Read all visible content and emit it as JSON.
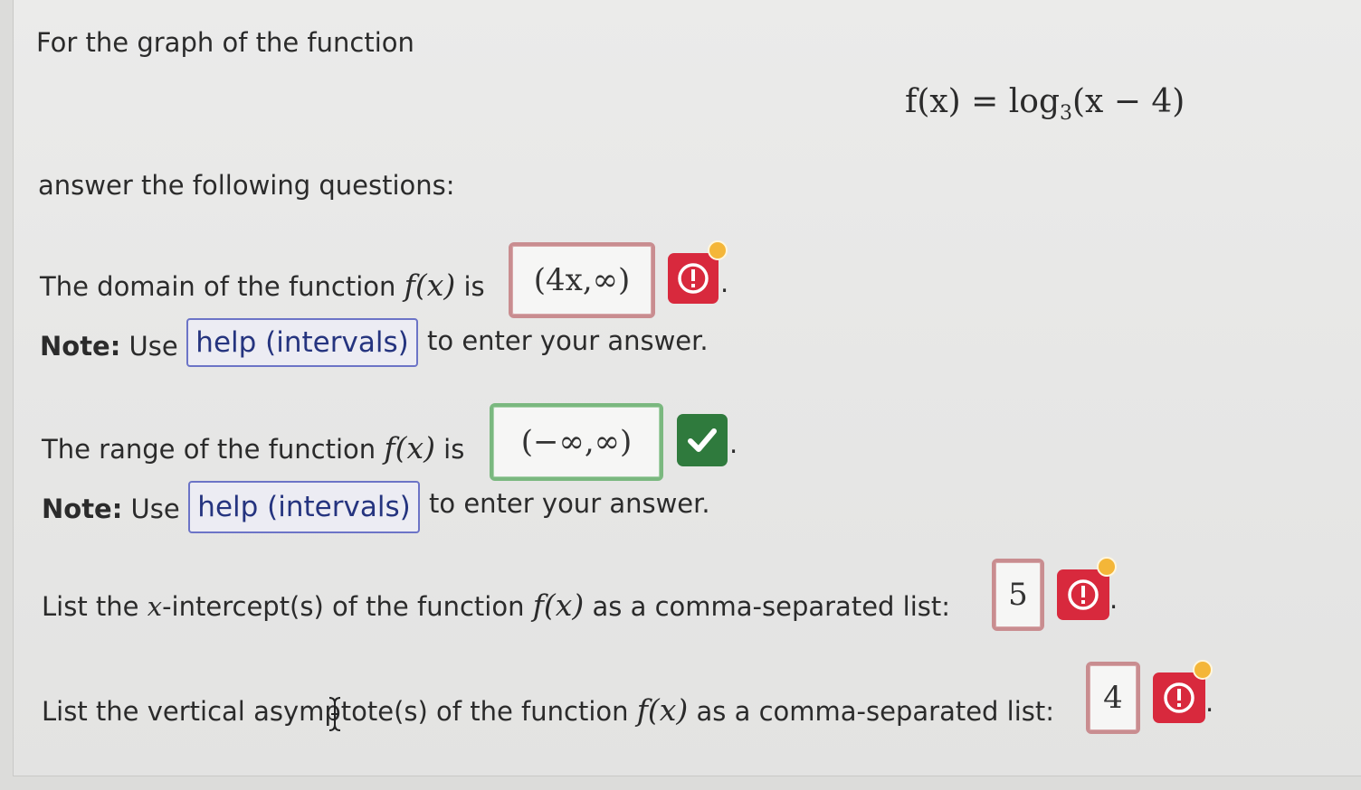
{
  "intro": "For the graph of the function",
  "formula": {
    "lhs": "f(x) = log",
    "base": "3",
    "arg": "(x − 4)"
  },
  "prompt": "answer the following questions:",
  "domain": {
    "text_before": "The domain of the function",
    "func": "f(x)",
    "text_after": "is",
    "answer": "(4x,∞)",
    "status": "error"
  },
  "range": {
    "text_before": "The range of the function",
    "func": "f(x)",
    "text_after": "is",
    "answer": "(−∞,∞)",
    "status": "correct"
  },
  "note": {
    "label": "Note:",
    "use": "Use",
    "help": "help (intervals)",
    "after": "to enter your answer."
  },
  "xint": {
    "text_before": "List the",
    "var": "x",
    "text_mid": "-intercept(s) of the function",
    "func": "f(x)",
    "text_after": "as a comma-separated list:",
    "answer": "5",
    "status": "error"
  },
  "vasym": {
    "text_before": "List the vertical asymptote(s) of the function",
    "func": "f(x)",
    "text_after": "as a comma-separated list:",
    "answer": "4",
    "status": "error"
  },
  "period": ".",
  "colors": {
    "error": "#d8293d",
    "correct": "#2f7a3d",
    "help_border": "#6c74c7",
    "badge_dot": "#f4b638"
  }
}
